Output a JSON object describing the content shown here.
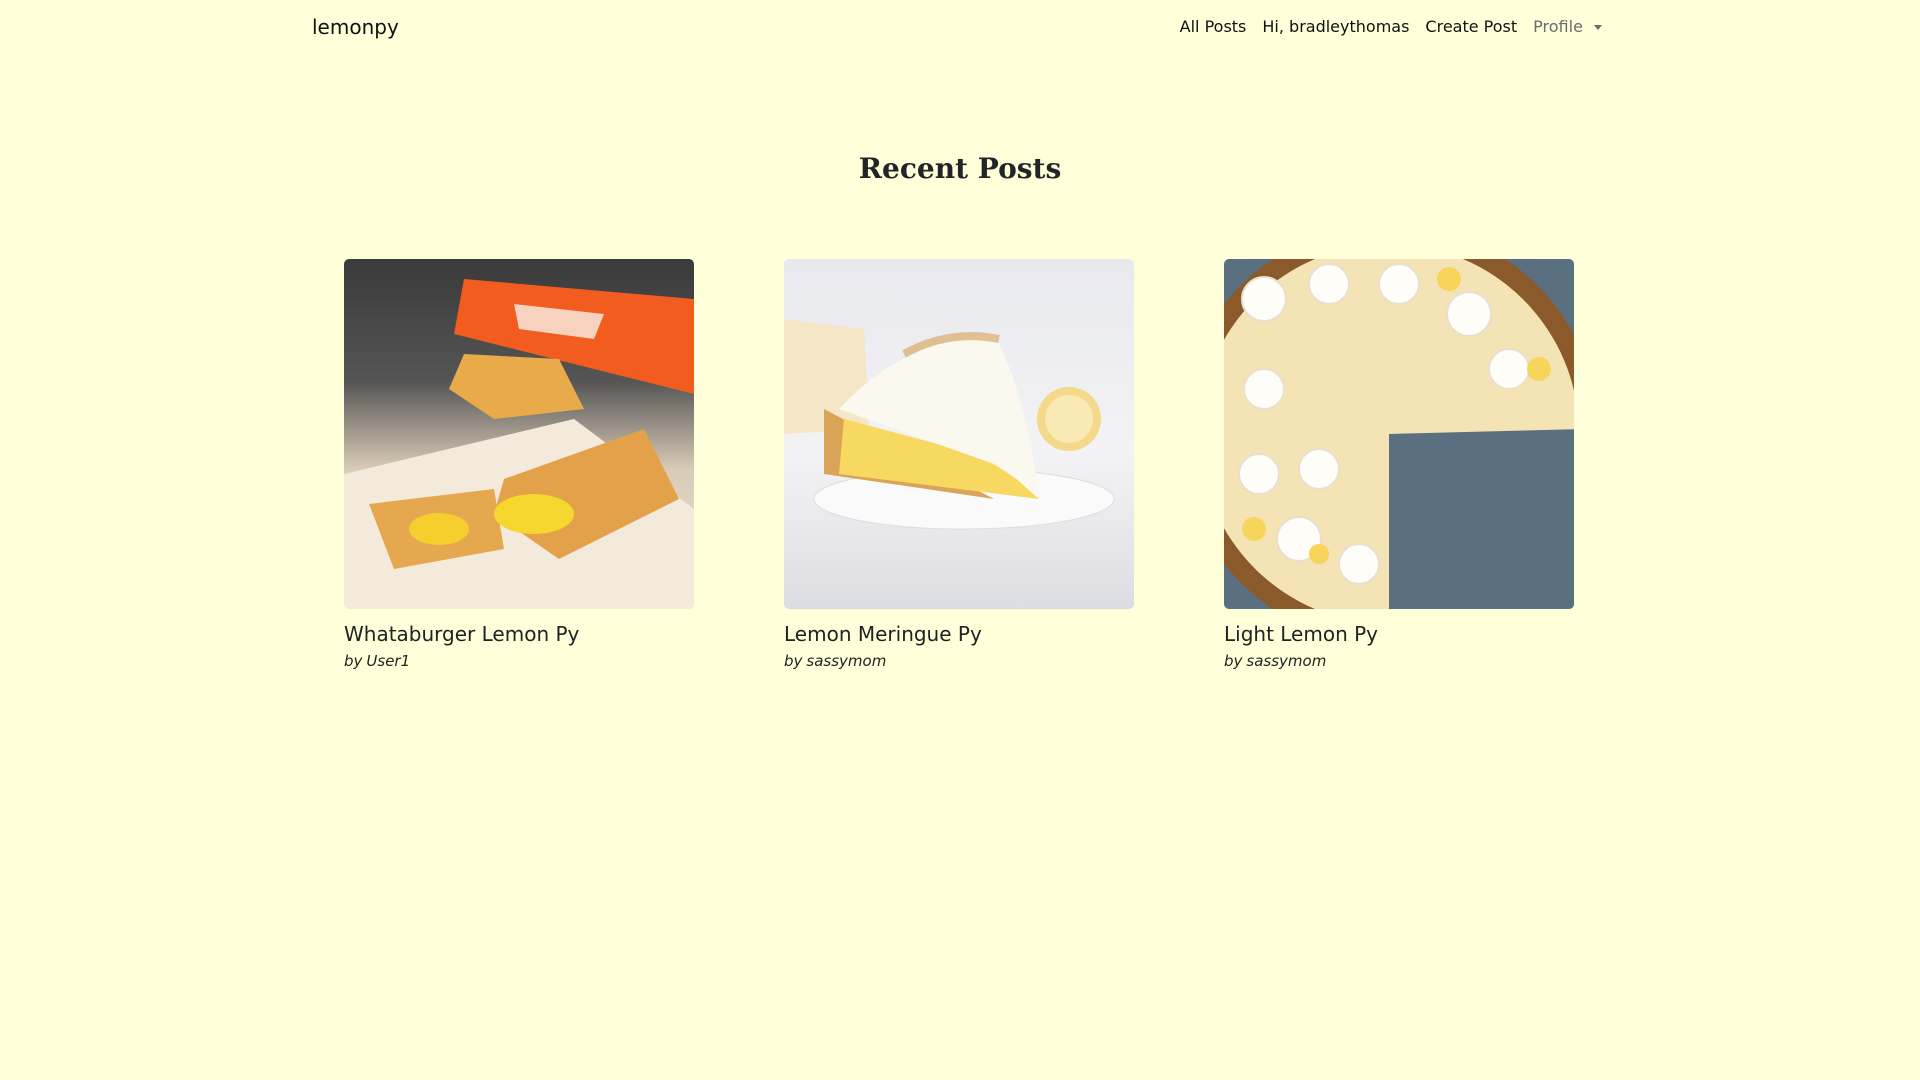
{
  "header": {
    "brand": "lemonpy",
    "nav": {
      "all_posts": "All Posts",
      "greeting": "Hi, bradleythomas",
      "create_post": "Create Post",
      "profile": "Profile"
    }
  },
  "page": {
    "title": "Recent Posts"
  },
  "posts": [
    {
      "title": "Whataburger Lemon Py",
      "author_prefix": "by",
      "author": "User1",
      "image_icon": "lemon-pastry-image"
    },
    {
      "title": "Lemon Meringue Py",
      "author_prefix": "by",
      "author": "sassymom",
      "image_icon": "meringue-pie-image"
    },
    {
      "title": "Light Lemon Py",
      "author_prefix": "by",
      "author": "sassymom",
      "image_icon": "cream-pie-image"
    }
  ],
  "colors": {
    "background": "#ffffd9",
    "text": "#212529",
    "muted": "#6c6c6c"
  }
}
